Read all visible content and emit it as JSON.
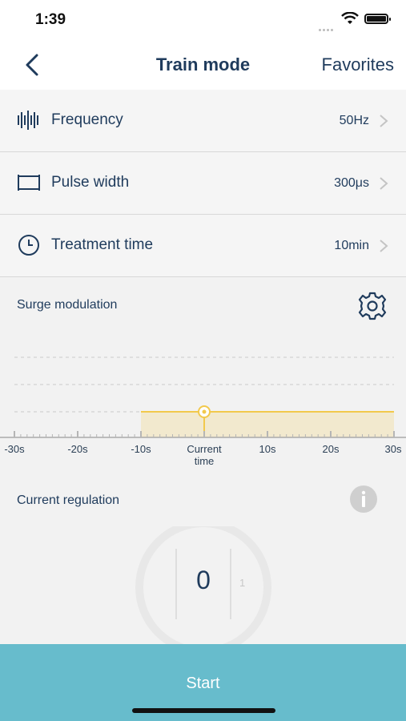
{
  "status_bar": {
    "time": "1:39"
  },
  "nav": {
    "back_icon": "chevron-left-icon",
    "title": "Train mode",
    "favorites_label": "Favorites"
  },
  "settings": [
    {
      "label": "Frequency",
      "value": "50Hz",
      "icon": "frequency-icon"
    },
    {
      "label": "Pulse width",
      "value": "300μs",
      "icon": "pulse-width-icon"
    },
    {
      "label": "Treatment time",
      "value": "10min",
      "icon": "clock-icon"
    }
  ],
  "surge": {
    "label": "Surge modulation",
    "settings_icon": "gear-icon",
    "ticks": [
      "-30s",
      "-20s",
      "-10s",
      "Current\ntime",
      "10s",
      "20s",
      "30s"
    ],
    "level_start_s": -10,
    "level_end_s": 30,
    "accent": "#f2c94c"
  },
  "regulation": {
    "label": "Current regulation",
    "info_icon": "info-icon",
    "current_value": "0",
    "next_value": "1"
  },
  "start": {
    "label": "Start",
    "color": "#67bccc"
  }
}
